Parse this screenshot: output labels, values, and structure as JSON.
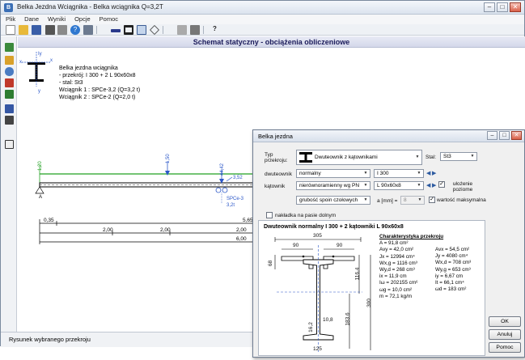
{
  "main": {
    "title": "Belka Jezdna Wciągnika - Belka wciągnika Q=3,2T",
    "menu": [
      "Plik",
      "Dane",
      "Wyniki",
      "Opcje",
      "Pomoc"
    ],
    "schema_title": "Schemat statyczny - obciążenia obliczeniowe",
    "info_lines": [
      "Belka jezdna wciągnika",
      "- przekrój: I 300 + 2 L 90x60x8",
      "- stal: St3",
      "Wciągnik 1 : SPCe-3,2 (Q=3,2 t)",
      "Wciągnik 2 : SPCe-2 (Q=2,0 t)"
    ],
    "axis_labels": {
      "iy": "Iy",
      "x": "x",
      "y": "y"
    },
    "loads": {
      "left": "1,20",
      "p1": "1,50",
      "p2": "44,42",
      "p3": "3,52"
    },
    "hoist_labels": [
      "SPCe-3",
      "3,2t"
    ],
    "dims": {
      "row1": [
        "0,35",
        "2,00",
        "5,65"
      ],
      "row2": [
        "2,00",
        "2,00",
        "6,00"
      ],
      "row3": [
        "6,00"
      ]
    },
    "status": "Rysunek wybranego przekroju",
    "colors": {
      "beam": "#22a022",
      "load": "#2b57c8",
      "dim": "#000000",
      "accent": "#1a1a5a"
    }
  },
  "dialog": {
    "title": "Belka jezdna",
    "type_label": "Typ przekroju:",
    "type_value": "Dwuteownik z kątownikami",
    "steel_label": "Stal:",
    "steel_value": "St3",
    "dwuteownik_label": "dwuteownik",
    "dwuteownik_kind": "normalny",
    "dwuteownik_size": "I 300",
    "katownik_label": "kątownik",
    "katownik_kind": "nierównoramienny wg PN",
    "katownik_size": "L 90x60x8",
    "ulozenie_label": "ułożenie poziome",
    "spoina_value": "grubość spoin czołowych",
    "a_label": "a [mm] =",
    "a_value": "8",
    "wartosc_label": "wartość maksymalna",
    "nakladka_label": "nakładka na pasie dolnym",
    "section_title": "Dwuteownik normalny I 300 + 2 kątowniki L 90x60x8",
    "char_title": "Charakterystyka przekroju",
    "props_left": [
      "A = 91,8 cm²",
      "Avy = 42,0 cm²",
      "Jx = 12994 cm⁴",
      "Wx,g = 1116 cm³",
      "Wy,d = 268 cm³",
      "ix = 11,9 cm",
      "Iω = 202155 cm⁶",
      "ωg = 10,0 cm²",
      "m = 72,1 kg/m"
    ],
    "props_right": [
      "Avx = 54,5 cm²",
      "Jy = 4080 cm⁴",
      "Wx,d = 708 cm³",
      "Wy,g = 653 cm³",
      "iy = 6,67 cm",
      "It = 66,1 cm⁴",
      "ωd = 183 cm²"
    ],
    "fig_dims": {
      "top": "305",
      "left90": "90",
      "right90": "90",
      "h68": "68",
      "h116": "116,4",
      "h183": "183,6",
      "h300": "300",
      "t108": "10,8",
      "t162": "16,2",
      "b125": "125"
    },
    "buttons": {
      "ok": "OK",
      "cancel": "Anuluj",
      "help": "Pomoc"
    }
  }
}
